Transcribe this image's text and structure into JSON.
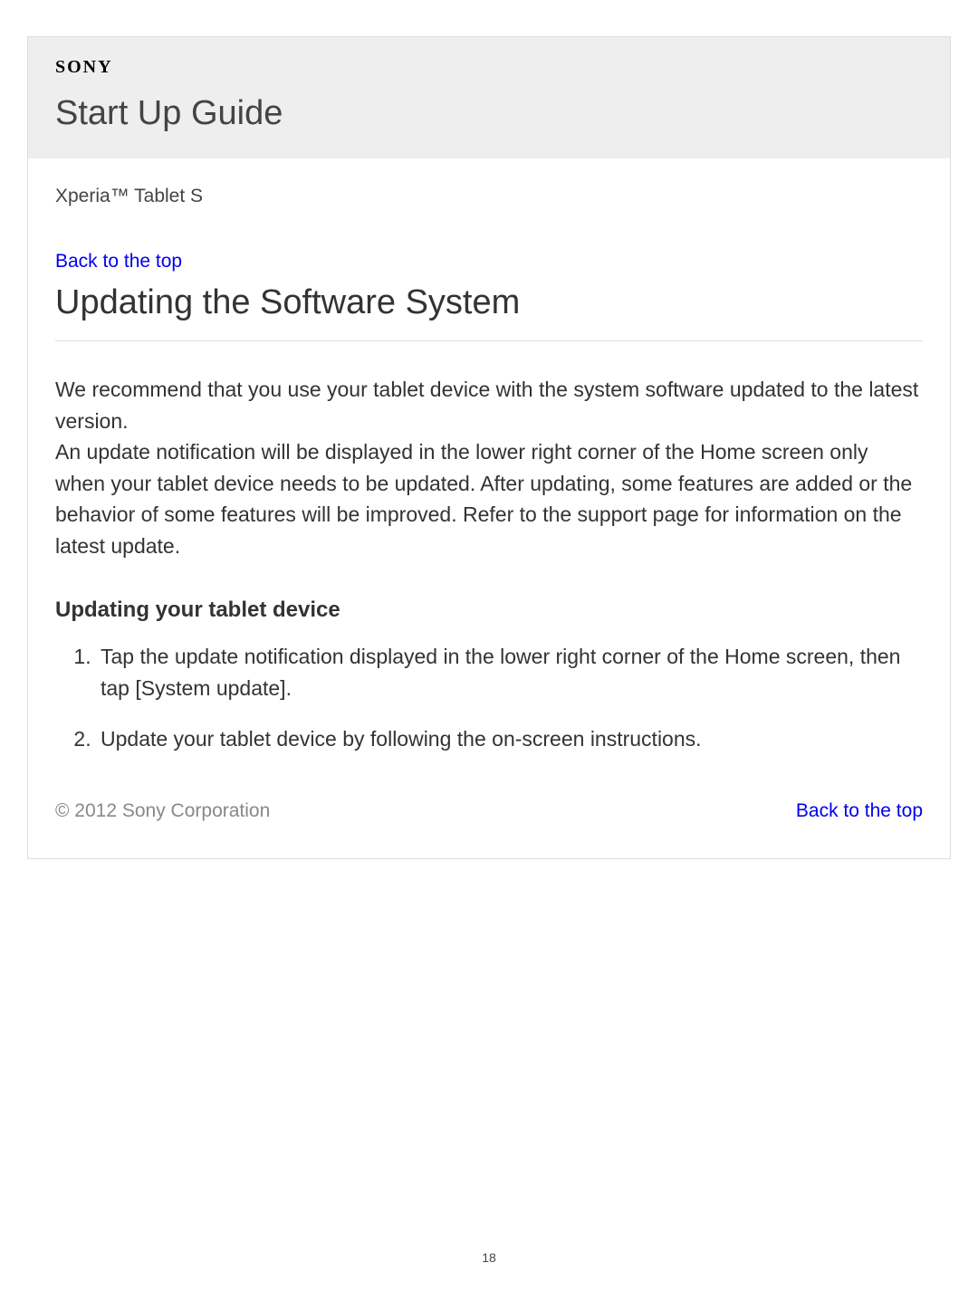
{
  "brand": "SONY",
  "guide_title": "Start Up Guide",
  "product_name": "Xperia™ Tablet S",
  "links": {
    "back_top": "Back to the top",
    "back_bottom": "Back to the top"
  },
  "article": {
    "title": "Updating the Software System",
    "intro": "We recommend that you use your tablet device with the system software updated to the latest version.\nAn update notification will be displayed in the lower right corner of the Home screen only when your tablet device needs to be updated. After updating, some features are added or the behavior of some features will be improved. Refer to the support page for information on the latest update.",
    "section_heading": "Updating your tablet device",
    "steps": [
      "Tap the update notification displayed in the lower right corner of the Home screen, then tap [System update].",
      "Update your tablet device by following the on-screen instructions."
    ]
  },
  "copyright": "© 2012 Sony Corporation",
  "page_number": "18"
}
